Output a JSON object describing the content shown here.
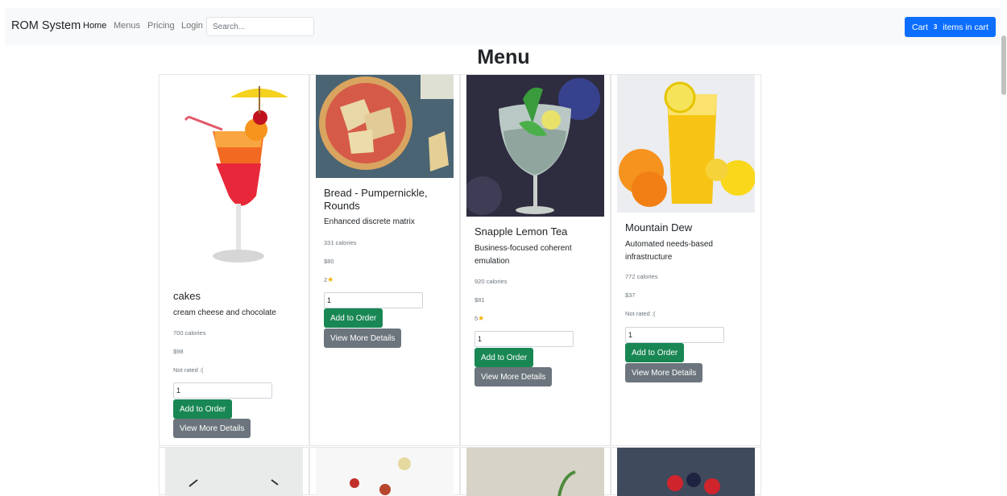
{
  "navbar": {
    "brand": "ROM System",
    "links": [
      "Home",
      "Menus",
      "Pricing",
      "Login"
    ],
    "search_placeholder": "Search...",
    "cart": {
      "label": "Cart",
      "count": "3",
      "suffix": "items in cart"
    }
  },
  "heading": "Menu",
  "cards": [
    {
      "title": "cakes",
      "description": "cream cheese and chocolate",
      "calories": "700 calories",
      "price": "$98",
      "rating": "Not rated :(",
      "quantity": "1",
      "add_label": "Add to Order",
      "details_label": "View More Details",
      "image_icon": "cocktail-image"
    },
    {
      "title": "Bread - Pumpernickle, Rounds",
      "description": "Enhanced discrete matrix",
      "calories": "331 calories",
      "price": "$80",
      "rating": "2",
      "quantity": "1",
      "add_label": "Add to Order",
      "details_label": "View More Details",
      "image_icon": "flatbread-image"
    },
    {
      "title": "Snapple Lemon Tea",
      "description": "Business-focused coherent emulation",
      "calories": "920 calories",
      "price": "$81",
      "rating": "5",
      "quantity": "1",
      "add_label": "Add to Order",
      "details_label": "View More Details",
      "image_icon": "gin-tonic-image"
    },
    {
      "title": "Mountain Dew",
      "description": "Automated needs-based infrastructure",
      "calories": "772 calories",
      "price": "$37",
      "rating": "Not rated :(",
      "quantity": "1",
      "add_label": "Add to Order",
      "details_label": "View More Details",
      "image_icon": "orange-juice-image"
    }
  ],
  "colors": {
    "primary": "#0d6efd",
    "success": "#198754",
    "secondary": "#6c757d",
    "star": "#f0b100"
  }
}
